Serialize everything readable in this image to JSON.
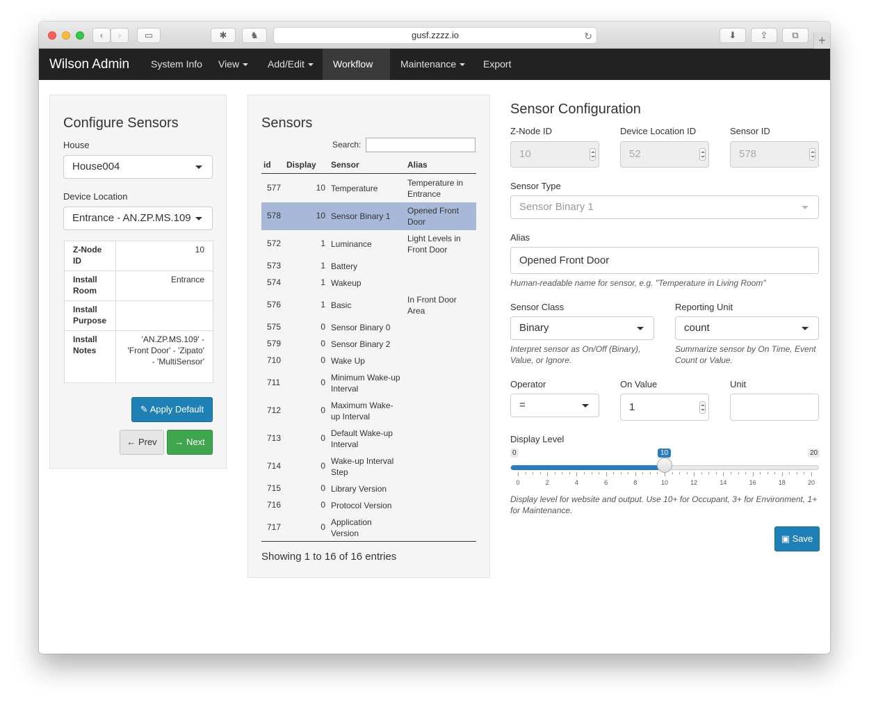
{
  "browser": {
    "url": "gusf.zzzz.io"
  },
  "nav": {
    "brand": "Wilson Admin",
    "items": [
      {
        "label": "System Info",
        "dropdown": false
      },
      {
        "label": "View",
        "dropdown": true
      },
      {
        "label": "Add/Edit",
        "dropdown": true
      },
      {
        "label": "Workflow",
        "dropdown": true,
        "active": true
      },
      {
        "label": "Maintenance",
        "dropdown": true
      },
      {
        "label": "Export",
        "dropdown": false
      }
    ]
  },
  "configure": {
    "title": "Configure Sensors",
    "house_label": "House",
    "house_value": "House004",
    "location_label": "Device Location",
    "location_value": "Entrance - AN.ZP.MS.109",
    "info": [
      {
        "k": "Z-Node ID",
        "v": "10"
      },
      {
        "k": "Install Room",
        "v": "Entrance"
      },
      {
        "k": "Install Purpose",
        "v": ""
      },
      {
        "k": "Install Notes",
        "v": "'AN.ZP.MS.109' - 'Front Door' - 'Zipato' - 'MultiSensor'"
      }
    ],
    "apply_default": "Apply Default",
    "prev": "Prev",
    "next": "Next"
  },
  "sensors": {
    "title": "Sensors",
    "search_label": "Search:",
    "search_value": "",
    "columns": [
      "id",
      "Display",
      "Sensor",
      "Alias"
    ],
    "rows": [
      {
        "id": "577",
        "display": "10",
        "sensor": "Temperature",
        "alias": "Temperature in Entrance"
      },
      {
        "id": "578",
        "display": "10",
        "sensor": "Sensor Binary 1",
        "alias": "Opened Front Door",
        "selected": true
      },
      {
        "id": "572",
        "display": "1",
        "sensor": "Luminance",
        "alias": "Light Levels in Front Door"
      },
      {
        "id": "573",
        "display": "1",
        "sensor": "Battery",
        "alias": ""
      },
      {
        "id": "574",
        "display": "1",
        "sensor": "Wakeup",
        "alias": ""
      },
      {
        "id": "576",
        "display": "1",
        "sensor": "Basic",
        "alias": "In Front Door Area"
      },
      {
        "id": "575",
        "display": "0",
        "sensor": "Sensor Binary 0",
        "alias": ""
      },
      {
        "id": "579",
        "display": "0",
        "sensor": "Sensor Binary 2",
        "alias": ""
      },
      {
        "id": "710",
        "display": "0",
        "sensor": "Wake Up",
        "alias": ""
      },
      {
        "id": "711",
        "display": "0",
        "sensor": "Minimum Wake-up Interval",
        "alias": ""
      },
      {
        "id": "712",
        "display": "0",
        "sensor": "Maximum Wake-up Interval",
        "alias": ""
      },
      {
        "id": "713",
        "display": "0",
        "sensor": "Default Wake-up Interval",
        "alias": ""
      },
      {
        "id": "714",
        "display": "0",
        "sensor": "Wake-up Interval Step",
        "alias": ""
      },
      {
        "id": "715",
        "display": "0",
        "sensor": "Library Version",
        "alias": ""
      },
      {
        "id": "716",
        "display": "0",
        "sensor": "Protocol Version",
        "alias": ""
      },
      {
        "id": "717",
        "display": "0",
        "sensor": "Application Version",
        "alias": ""
      }
    ],
    "footer": "Showing 1 to 16 of 16 entries"
  },
  "sensor_config": {
    "title": "Sensor Configuration",
    "znode_label": "Z-Node ID",
    "znode_value": "10",
    "devloc_label": "Device Location ID",
    "devloc_value": "52",
    "sensorid_label": "Sensor ID",
    "sensorid_value": "578",
    "type_label": "Sensor Type",
    "type_value": "Sensor Binary 1",
    "alias_label": "Alias",
    "alias_value": "Opened Front Door",
    "alias_help": "Human-readable name for sensor, e.g. \"Temperature in Living Room\"",
    "class_label": "Sensor Class",
    "class_value": "Binary",
    "class_help": "Interpret sensor as On/Off (Binary), Value, or Ignore.",
    "unit_label": "Reporting Unit",
    "unit_value": "count",
    "unit_help": "Summarize sensor by On Time, Event Count or Value.",
    "operator_label": "Operator",
    "operator_value": "=",
    "onvalue_label": "On Value",
    "onvalue_value": "1",
    "unitfield_label": "Unit",
    "unitfield_value": "",
    "display_label": "Display Level",
    "display_min": "0",
    "display_max": "20",
    "display_value": "10",
    "display_ticks": [
      "0",
      "2",
      "4",
      "6",
      "8",
      "10",
      "12",
      "14",
      "16",
      "18",
      "20"
    ],
    "display_help": "Display level for website and output. Use 10+ for Occupant, 3+ for Environment, 1+ for Maintenance.",
    "save": "Save"
  },
  "colors": {
    "navbar": "#222222",
    "primary": "#1f80b5",
    "success": "#3fa64f",
    "selected_row": "#a7b8d8",
    "slider": "#2d7bbf"
  }
}
